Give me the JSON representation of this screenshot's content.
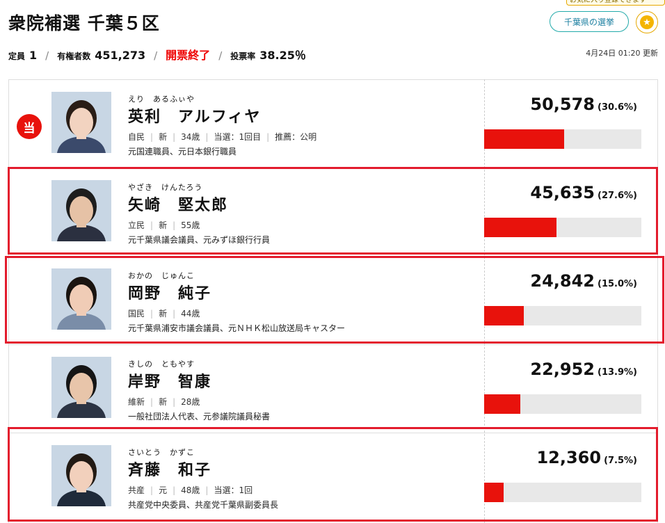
{
  "header": {
    "title": "衆院補選 千葉５区",
    "seats_label": "定員",
    "seats": "1",
    "voters_label": "有権者数",
    "voters": "451,273",
    "status": "開票終了",
    "turnout_label": "投票率",
    "turnout": "38.25％",
    "updated": "4月24日 01:20 更新",
    "pref_button": "千葉県の選挙",
    "tooltip": "お気に入り登録できます"
  },
  "colors": {
    "accent_red": "#e8120c",
    "highlight": "#e31c2d",
    "link": "#1b7fa0"
  },
  "candidates": [
    {
      "kana": "えり　あるふぃや",
      "name": "英利　アルフィヤ",
      "meta": [
        "自民",
        "新",
        "34歳",
        "当選：1回目",
        "推薦：公明"
      ],
      "career": "元国連職員、元日本銀行職員",
      "votes": "50,578",
      "pct": "(30.6%)",
      "share": 0.306,
      "elected": "当"
    },
    {
      "kana": "やざき　けんたろう",
      "name": "矢崎　堅太郎",
      "meta": [
        "立民",
        "新",
        "55歳"
      ],
      "career": "元千葉県議会議員、元みずほ銀行行員",
      "votes": "45,635",
      "pct": "(27.6%)",
      "share": 0.276
    },
    {
      "kana": "おかの　じゅんこ",
      "name": "岡野　純子",
      "meta": [
        "国民",
        "新",
        "44歳"
      ],
      "career": "元千葉県浦安市議会議員、元ＮＨＫ松山放送局キャスター",
      "votes": "24,842",
      "pct": "(15.0%)",
      "share": 0.15
    },
    {
      "kana": "きしの　ともやす",
      "name": "岸野　智康",
      "meta": [
        "維新",
        "新",
        "28歳"
      ],
      "career": "一般社団法人代表、元参議院議員秘書",
      "votes": "22,952",
      "pct": "(13.9%)",
      "share": 0.139
    },
    {
      "kana": "さいとう　かずこ",
      "name": "斉藤　和子",
      "meta": [
        "共産",
        "元",
        "48歳",
        "当選：1回"
      ],
      "career": "共産党中央委員、共産党千葉県副委員長",
      "votes": "12,360",
      "pct": "(7.5%)",
      "share": 0.075
    }
  ]
}
